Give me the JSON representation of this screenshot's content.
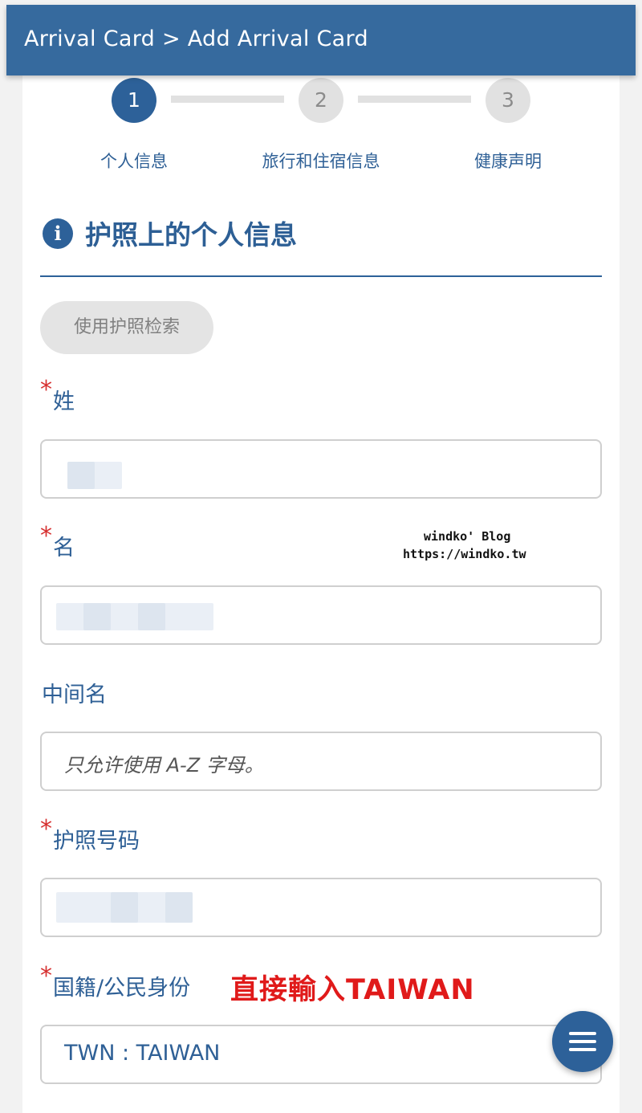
{
  "header": {
    "title": "Arrival Card > Add Arrival Card"
  },
  "stepper": {
    "steps": [
      {
        "number": "1",
        "label": "个人信息",
        "active": true
      },
      {
        "number": "2",
        "label": "旅行和住宿信息",
        "active": false
      },
      {
        "number": "3",
        "label": "健康声明",
        "active": false
      }
    ]
  },
  "section": {
    "title": "护照上的个人信息",
    "icon": "info-icon",
    "passport_search_button": "使用护照检索"
  },
  "form": {
    "required_mark": "*",
    "surname": {
      "label": "姓"
    },
    "given_name": {
      "label": "名"
    },
    "middle_name": {
      "label": "中间名",
      "placeholder": "只允许使用 A-Z 字母。"
    },
    "passport_number": {
      "label": "护照号码"
    },
    "nationality": {
      "label": "国籍/公民身份",
      "value": "TWN : TAIWAN"
    }
  },
  "watermark": {
    "line1": "windko' Blog",
    "line2": "https://windko.tw"
  },
  "annotation": "直接輸入TAIWAN",
  "colors": {
    "primary": "#2d6199",
    "header_bg": "#366a9e",
    "required": "#d62f2f",
    "annotation": "#e01a1a"
  },
  "fab": {
    "icon": "menu-icon"
  }
}
